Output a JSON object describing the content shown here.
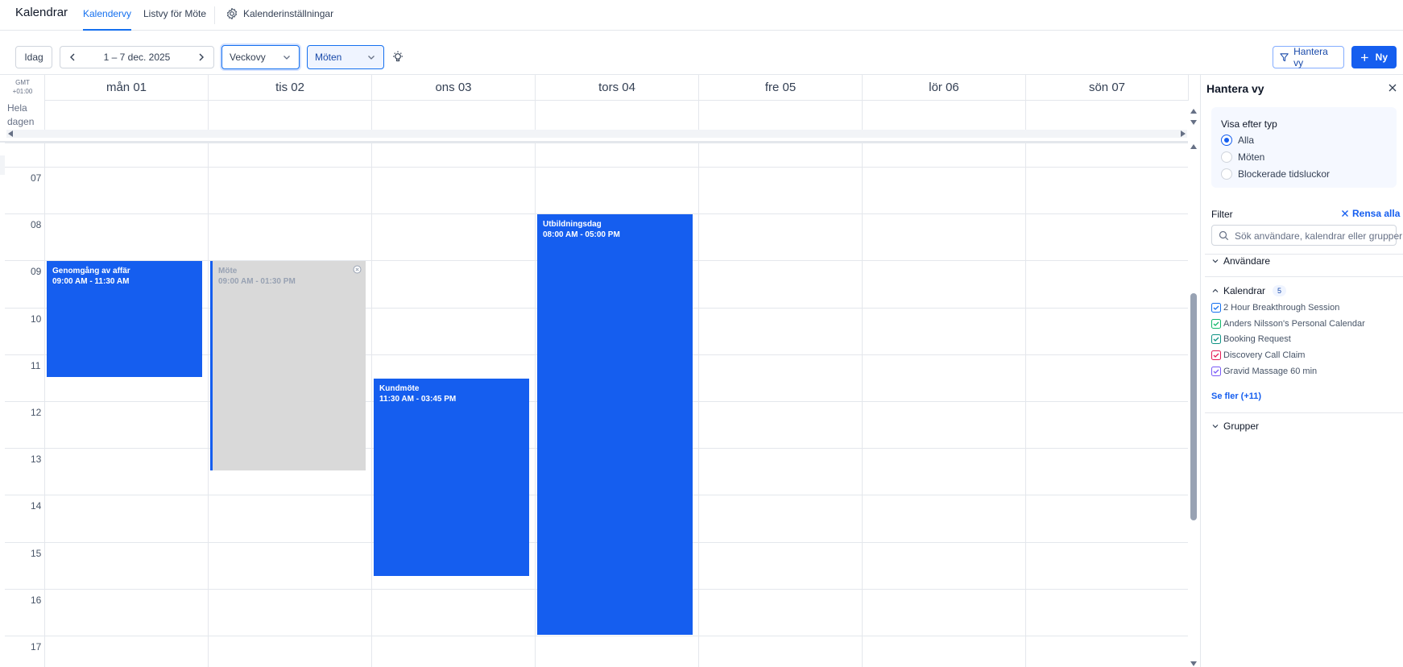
{
  "topnav": {
    "app_title": "Kalendrar",
    "tabs": [
      {
        "label": "Kalendervy",
        "active": true
      },
      {
        "label": "Listvy för Möte",
        "active": false
      }
    ],
    "settings_label": "Kalenderinställningar"
  },
  "toolbar": {
    "today_label": "Idag",
    "date_range": "1 – 7 dec. 2025",
    "view_select": "Veckovy",
    "type_select": "Möten",
    "manage_view_label": "Hantera vy",
    "new_label": "Ny"
  },
  "calendar": {
    "gmt_line1": "GMT",
    "gmt_line2": "+01:00",
    "allday_line1": "Hela",
    "allday_line2": "dagen",
    "days": [
      "mån 01",
      "tis 02",
      "ons 03",
      "tors 04",
      "fre 05",
      "lör 06",
      "sön 07"
    ],
    "hours": [
      "07",
      "08",
      "09",
      "10",
      "11",
      "12",
      "13",
      "14",
      "15",
      "16",
      "17"
    ],
    "events": [
      {
        "title": "Genomgång av affär",
        "time": "09:00 AM - 11:30 AM",
        "day": 0,
        "style": "blue"
      },
      {
        "title": "Möte",
        "time": "09:00 AM - 01:30 PM",
        "day": 1,
        "style": "gray"
      },
      {
        "title": "Kundmöte",
        "time": "11:30 AM - 03:45 PM",
        "day": 2,
        "style": "blue"
      },
      {
        "title": "Utbildningsdag",
        "time": "08:00 AM - 05:00 PM",
        "day": 3,
        "style": "blue"
      }
    ]
  },
  "panel": {
    "title": "Hantera vy",
    "type_title": "Visa efter typ",
    "types": [
      {
        "label": "Alla",
        "selected": true
      },
      {
        "label": "Möten",
        "selected": false
      },
      {
        "label": "Blockerade tidsluckor",
        "selected": false
      }
    ],
    "filter_label": "Filter",
    "clear_all_label": "Rensa alla",
    "search_placeholder": "Sök användare, kalendrar eller grupper",
    "users_label": "Användare",
    "calendars_label": "Kalendrar",
    "calendars_count": "5",
    "calendars": [
      {
        "label": "2 Hour Breakthrough Session",
        "color": "#1570ef"
      },
      {
        "label": "Anders Nilsson's Personal Calendar",
        "color": "#12b76a"
      },
      {
        "label": "Booking Request",
        "color": "#0e9384"
      },
      {
        "label": "Discovery Call Claim",
        "color": "#e31b54"
      },
      {
        "label": "Gravid Massage 60 min",
        "color": "#7a5af8"
      }
    ],
    "see_more_label": "Se fler (+11)",
    "groups_label": "Grupper"
  },
  "colors": {
    "accent": "#155eef",
    "event_blue": "#155eef",
    "event_gray": "#d9d9d9"
  }
}
